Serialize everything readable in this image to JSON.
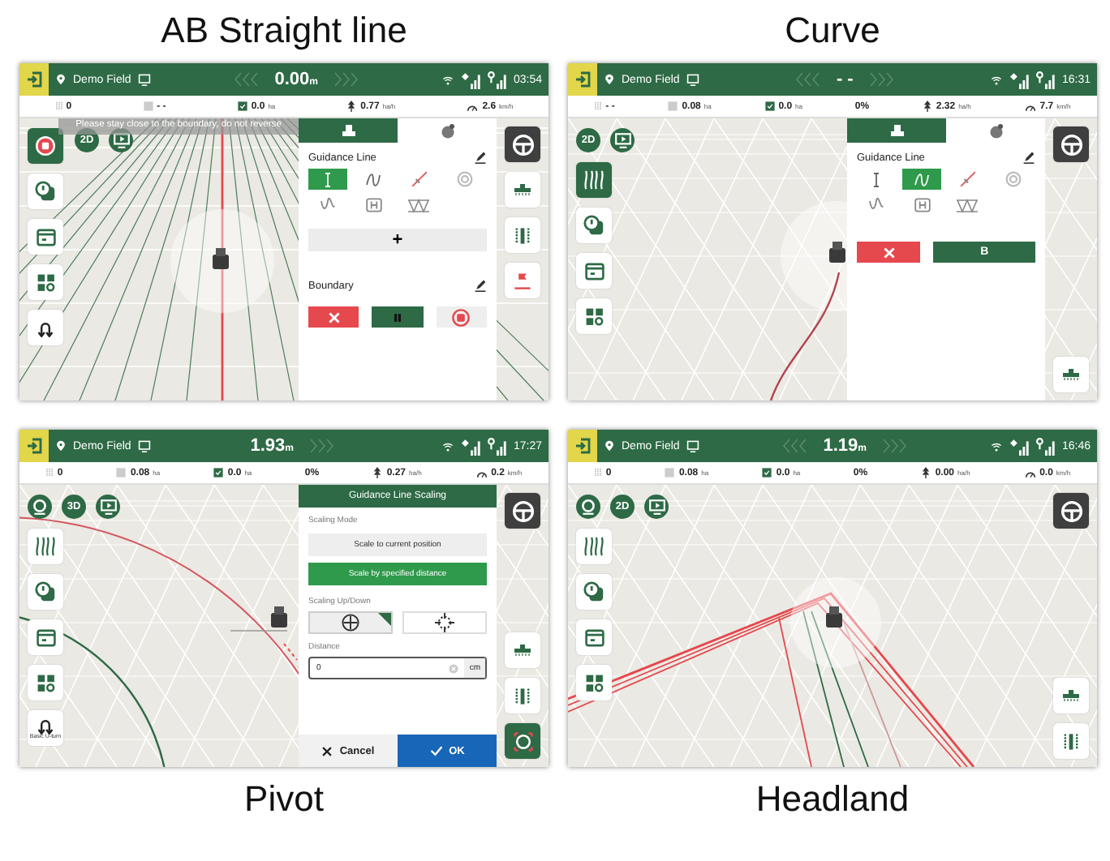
{
  "panels": [
    {
      "caption": "AB Straight line",
      "kind": "caption_above",
      "map": {
        "kind": "straight"
      },
      "view_place": {
        "kind": "beside"
      },
      "top_bar": {
        "field": "Demo Field",
        "distance": "0.00",
        "unit": "m",
        "chevrons_left": true,
        "chevrons_right": true,
        "time": "03:54"
      },
      "stats": [
        {
          "kind": "width",
          "value": "0"
        },
        {
          "kind": "area",
          "value": "- -"
        },
        {
          "kind": "worked",
          "value": "0.0",
          "unit": "ha"
        },
        {
          "kind": "rate",
          "value": "0.77",
          "unit": "ha/h"
        },
        {
          "kind": "speed",
          "value": "2.6",
          "unit": "km/h"
        }
      ],
      "toast": "Please stay close to the boundary, do not reverse",
      "view_buttons": [
        {
          "kind": "mode",
          "label": "2D"
        },
        {
          "kind": "video"
        }
      ],
      "left_tools": [
        {
          "kind": "record",
          "selected": true
        },
        {
          "kind": "alerts",
          "selected": false
        },
        {
          "kind": "layers",
          "selected": false
        },
        {
          "kind": "apps",
          "selected": false
        },
        {
          "kind": "uturn",
          "selected": false
        }
      ],
      "right_tools": {
        "top": [
          {
            "kind": "steering",
            "selected": false
          },
          {
            "kind": "implement",
            "selected": false
          },
          {
            "kind": "sections",
            "selected": false
          },
          {
            "kind": "marker",
            "selected": false
          }
        ]
      },
      "side_panel": {
        "kind": "guidance",
        "tabs": [
          {
            "kind": "vehicle",
            "selected": true
          },
          {
            "kind": "globe",
            "selected": false
          }
        ],
        "title": "Guidance Line",
        "line_types": [
          {
            "kind": "ab",
            "selected": true
          },
          {
            "kind": "curve",
            "selected": false
          },
          {
            "kind": "angle",
            "selected": false
          },
          {
            "kind": "pivot",
            "selected": false
          },
          {
            "kind": "multi",
            "selected": false
          },
          {
            "kind": "headland",
            "selected": false
          },
          {
            "kind": "trapezoid",
            "selected": false
          }
        ],
        "add_label": "+",
        "boundary": {
          "title": "Boundary",
          "actions": [
            {
              "kind": "delete"
            },
            {
              "kind": "pause"
            },
            {
              "kind": "stop"
            }
          ]
        }
      }
    },
    {
      "caption": "Curve",
      "kind": "caption_above",
      "map": {
        "kind": "curve"
      },
      "view_place": {
        "kind": "top"
      },
      "top_bar": {
        "field": "Demo Field",
        "distance": "- -",
        "chevrons_left": true,
        "chevrons_right": true,
        "time": "16:31"
      },
      "stats": [
        {
          "kind": "width",
          "value": "- -"
        },
        {
          "kind": "area",
          "value": "0.08",
          "unit": "ha"
        },
        {
          "kind": "worked",
          "value": "0.0",
          "unit": "ha"
        },
        {
          "kind": "percent",
          "value": "0%"
        },
        {
          "kind": "rate",
          "value": "2.32",
          "unit": "ha/h"
        },
        {
          "kind": "speed",
          "value": "7.7",
          "unit": "km/h"
        }
      ],
      "view_buttons": [
        {
          "kind": "mode",
          "label": "2D"
        },
        {
          "kind": "video"
        }
      ],
      "left_tools": [
        {
          "kind": "lines",
          "selected": true
        },
        {
          "kind": "alerts",
          "selected": false
        },
        {
          "kind": "layers",
          "selected": false
        },
        {
          "kind": "apps",
          "selected": false
        }
      ],
      "right_tools": {
        "top": [
          {
            "kind": "steering",
            "selected": false
          }
        ],
        "bottom": [
          {
            "kind": "implement",
            "selected": false
          }
        ]
      },
      "side_panel": {
        "kind": "guidance",
        "tabs": [
          {
            "kind": "vehicle",
            "selected": true
          },
          {
            "kind": "globe",
            "selected": false
          }
        ],
        "title": "Guidance Line",
        "line_types": [
          {
            "kind": "ab",
            "selected": false
          },
          {
            "kind": "curve",
            "selected": true
          },
          {
            "kind": "angle",
            "selected": false
          },
          {
            "kind": "pivot",
            "selected": false
          },
          {
            "kind": "multi",
            "selected": false
          },
          {
            "kind": "headland",
            "selected": false
          },
          {
            "kind": "trapezoid",
            "selected": false
          }
        ],
        "actions": [
          {
            "kind": "delete"
          },
          {
            "kind": "point",
            "label": "B"
          }
        ]
      }
    },
    {
      "caption": "Pivot",
      "kind": "caption_below",
      "map": {
        "kind": "pivot"
      },
      "view_place": {
        "kind": "top"
      },
      "top_bar": {
        "field": "Demo Field",
        "distance": "1.93",
        "unit": "m",
        "chevrons_left": false,
        "chevrons_right": true,
        "time": "17:27"
      },
      "stats": [
        {
          "kind": "width",
          "value": "0"
        },
        {
          "kind": "area",
          "value": "0.08",
          "unit": "ha"
        },
        {
          "kind": "worked",
          "value": "0.0",
          "unit": "ha"
        },
        {
          "kind": "percent",
          "value": "0%"
        },
        {
          "kind": "rate",
          "value": "0.27",
          "unit": "ha/h"
        },
        {
          "kind": "speed",
          "value": "0.2",
          "unit": "km/h"
        }
      ],
      "view_buttons": [
        {
          "kind": "camera"
        },
        {
          "kind": "mode",
          "label": "3D"
        },
        {
          "kind": "video"
        }
      ],
      "left_tools": [
        {
          "kind": "lines",
          "selected": false
        },
        {
          "kind": "alerts",
          "selected": false
        },
        {
          "kind": "layers",
          "selected": false
        },
        {
          "kind": "apps",
          "selected": false
        },
        {
          "kind": "uturn",
          "selected": false,
          "label": "Basic U-turn"
        }
      ],
      "right_tools": {
        "top": [
          {
            "kind": "steering",
            "selected": false
          }
        ],
        "bottom": [
          {
            "kind": "implement",
            "selected": false
          },
          {
            "kind": "sections",
            "selected": false
          },
          {
            "kind": "target",
            "selected": true
          }
        ]
      },
      "side_panel": {
        "kind": "scaling",
        "title": "Guidance Line Scaling",
        "mode_label": "Scaling Mode",
        "options": [
          {
            "label": "Scale to current position",
            "selected": false
          },
          {
            "label": "Scale by specified distance",
            "selected": true
          }
        ],
        "direction_label": "Scaling Up/Down",
        "directions": [
          {
            "kind": "expand",
            "selected": true
          },
          {
            "kind": "shrink",
            "selected": false
          }
        ],
        "distance_label": "Distance",
        "distance_value": "0",
        "distance_unit": "cm",
        "cancel": "Cancel",
        "ok": "OK"
      }
    },
    {
      "caption": "Headland",
      "kind": "caption_below",
      "map": {
        "kind": "headland"
      },
      "view_place": {
        "kind": "top"
      },
      "top_bar": {
        "field": "Demo Field",
        "distance": "1.19",
        "unit": "m",
        "chevrons_left": true,
        "chevrons_right": true,
        "time": "16:46"
      },
      "stats": [
        {
          "kind": "width",
          "value": "0"
        },
        {
          "kind": "area",
          "value": "0.08",
          "unit": "ha"
        },
        {
          "kind": "worked",
          "value": "0.0",
          "unit": "ha"
        },
        {
          "kind": "percent",
          "value": "0%"
        },
        {
          "kind": "rate",
          "value": "0.00",
          "unit": "ha/h"
        },
        {
          "kind": "speed",
          "value": "0.0",
          "unit": "km/h"
        }
      ],
      "view_buttons": [
        {
          "kind": "camera"
        },
        {
          "kind": "mode",
          "label": "2D"
        },
        {
          "kind": "video"
        }
      ],
      "left_tools": [
        {
          "kind": "lines",
          "selected": false
        },
        {
          "kind": "alerts",
          "selected": false
        },
        {
          "kind": "layers",
          "selected": false
        },
        {
          "kind": "apps",
          "selected": false
        }
      ],
      "right_tools": {
        "top": [
          {
            "kind": "steering",
            "selected": false
          }
        ],
        "bottom": [
          {
            "kind": "implement",
            "selected": false
          },
          {
            "kind": "sections",
            "selected": false
          }
        ]
      }
    }
  ]
}
